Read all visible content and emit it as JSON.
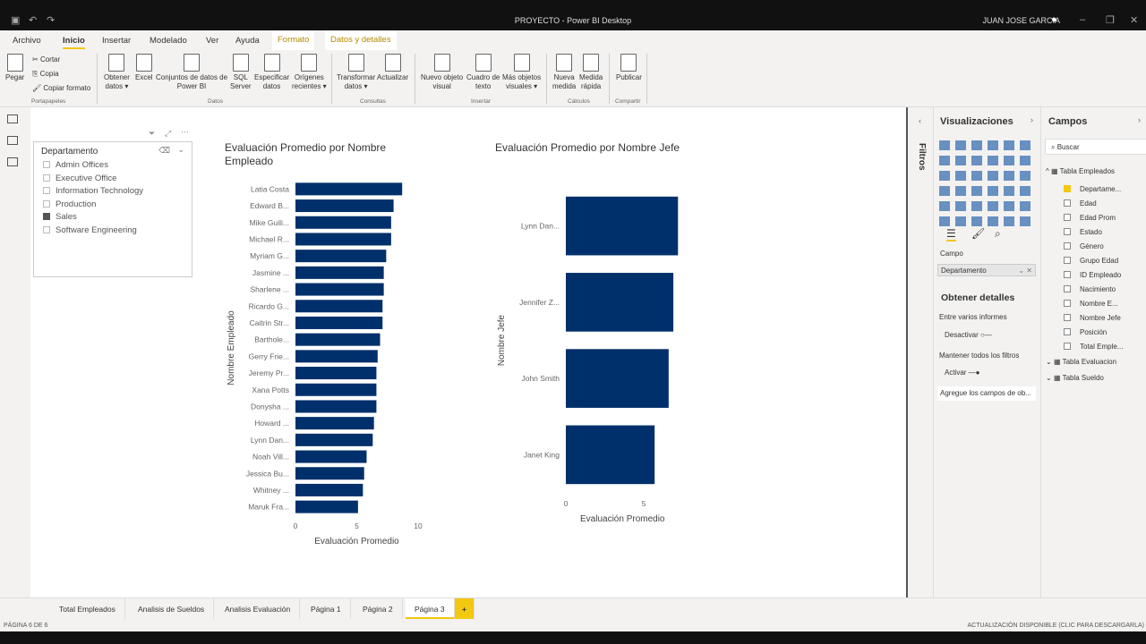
{
  "window": {
    "title": "PROYECTO - Power BI Desktop",
    "user": "JUAN JOSE GARCIA"
  },
  "menu_tabs": [
    "Archivo",
    "Inicio",
    "Insertar",
    "Modelado",
    "Ver",
    "Ayuda",
    "Formato",
    "Datos y detalles"
  ],
  "ribbon": {
    "clipboard": {
      "paste": "Pegar",
      "cut": "Cortar",
      "copy": "Copia",
      "format_painter": "Copiar formato",
      "group": "Portapapeles"
    },
    "data": [
      [
        "Obtener",
        "datos ▾"
      ],
      [
        "Excel",
        ""
      ],
      [
        "Conjuntos de datos de",
        "Power BI"
      ],
      [
        "SQL",
        "Server"
      ],
      [
        "Especificar",
        "datos"
      ],
      [
        "Orígenes",
        "recientes ▾"
      ]
    ],
    "data_group": "Datos",
    "queries": [
      [
        "Transformar",
        "datos ▾"
      ],
      [
        "Actualizar",
        ""
      ]
    ],
    "queries_group": "Consultas",
    "insert": [
      [
        "Nuevo objeto",
        "visual"
      ],
      [
        "Cuadro de",
        "texto"
      ],
      [
        "Más objetos",
        "visuales ▾"
      ]
    ],
    "insert_group": "Insertar",
    "calc": [
      [
        "Nueva",
        "medida"
      ],
      [
        "Medida",
        "rápida"
      ]
    ],
    "calc_group": "Cálculos",
    "share": [
      [
        "Publicar",
        ""
      ]
    ],
    "share_group": "Compartir"
  },
  "slicer": {
    "title": "Departamento",
    "items": [
      {
        "label": "Admin Offices",
        "checked": false
      },
      {
        "label": "Executive Office",
        "checked": false
      },
      {
        "label": "Information Technology",
        "checked": false
      },
      {
        "label": "Production",
        "checked": false
      },
      {
        "label": "Sales",
        "checked": true
      },
      {
        "label": "Software Engineering",
        "checked": false
      }
    ]
  },
  "chart_data": [
    {
      "type": "bar",
      "orientation": "horizontal",
      "title": "Evaluación Promedio por Nombre Empleado",
      "xlabel": "Evaluación Promedio",
      "ylabel": "Nombre Empleado",
      "xlim": [
        0,
        10
      ],
      "xticks": [
        0,
        5,
        10
      ],
      "color": "#00306b",
      "grid": false,
      "categories": [
        "Latia Costa",
        "Edward B...",
        "Mike Guili...",
        "Michael R...",
        "Myriam G...",
        "Jasmine ...",
        "Sharlene ...",
        "Ricardo G...",
        "Caitrin Str...",
        "Bartholе...",
        "Gerry Frie...",
        "Jeremy Pr...",
        "Xana Potts",
        "Donysha ...",
        "Howard ...",
        "Lynn Dan...",
        "Noah Vill...",
        "Jessica Bu...",
        "Whitney ...",
        "Maruk Fra..."
      ],
      "values": [
        8.7,
        8.0,
        7.8,
        7.8,
        7.4,
        7.2,
        7.2,
        7.1,
        7.1,
        6.9,
        6.7,
        6.6,
        6.6,
        6.6,
        6.4,
        6.3,
        5.8,
        5.6,
        5.5,
        5.1
      ]
    },
    {
      "type": "bar",
      "orientation": "horizontal",
      "title": "Evaluación Promedio por Nombre Jefe",
      "xlabel": "Evaluación Promedio",
      "ylabel": "Nombre Jefe",
      "xlim": [
        0,
        7.5
      ],
      "xticks": [
        0,
        5
      ],
      "color": "#00306b",
      "grid": false,
      "categories": [
        "Lynn Dan...",
        "Jennifer Z...",
        "John Smith",
        "Janet King"
      ],
      "values": [
        7.2,
        6.9,
        6.6,
        5.7
      ]
    }
  ],
  "filters_label": "Filtros",
  "visualizations": {
    "title": "Visualizaciones",
    "field_label": "Campo",
    "field_value": "Departamento",
    "details_title": "Obtener detalles",
    "cross_report": "Entre varios informes",
    "cross_toggle": "Desactivar",
    "keep_filters": "Mantener todos los filtros",
    "keep_toggle": "Activar",
    "drop_hint": "Agregue los campos de ob..."
  },
  "fields": {
    "title": "Campos",
    "search_placeholder": "Buscar",
    "tables": [
      {
        "name": "Tabla Empleados",
        "expanded": true,
        "fields": [
          {
            "name": "Departame...",
            "checked": true
          },
          {
            "name": "Edad",
            "checked": false
          },
          {
            "name": "Edad Prom",
            "checked": false
          },
          {
            "name": "Estado",
            "checked": false
          },
          {
            "name": "Género",
            "checked": false
          },
          {
            "name": "Grupo Edad",
            "checked": false
          },
          {
            "name": "ID Empleado",
            "checked": false
          },
          {
            "name": "Nacimiento",
            "checked": false
          },
          {
            "name": "Nombre E...",
            "checked": false
          },
          {
            "name": "Nombre Jefe",
            "checked": false
          },
          {
            "name": "Posición",
            "checked": false
          },
          {
            "name": "Total Emple...",
            "checked": false
          }
        ]
      },
      {
        "name": "Tabla Evaluacion",
        "expanded": false
      },
      {
        "name": "Tabla Sueldo",
        "expanded": false
      }
    ]
  },
  "pages": {
    "tabs": [
      "Total Empleados",
      "Analisis de Sueldos",
      "Analisis Evaluación",
      "Página 1",
      "Página 2",
      "Página 3"
    ],
    "active": "Página 3",
    "add": "+"
  },
  "status": {
    "page": "PÁGINA 6 DE 6",
    "update": "ACTUALIZACIÓN DISPONIBLE (CLIC PARA DESCARGARLA)"
  }
}
